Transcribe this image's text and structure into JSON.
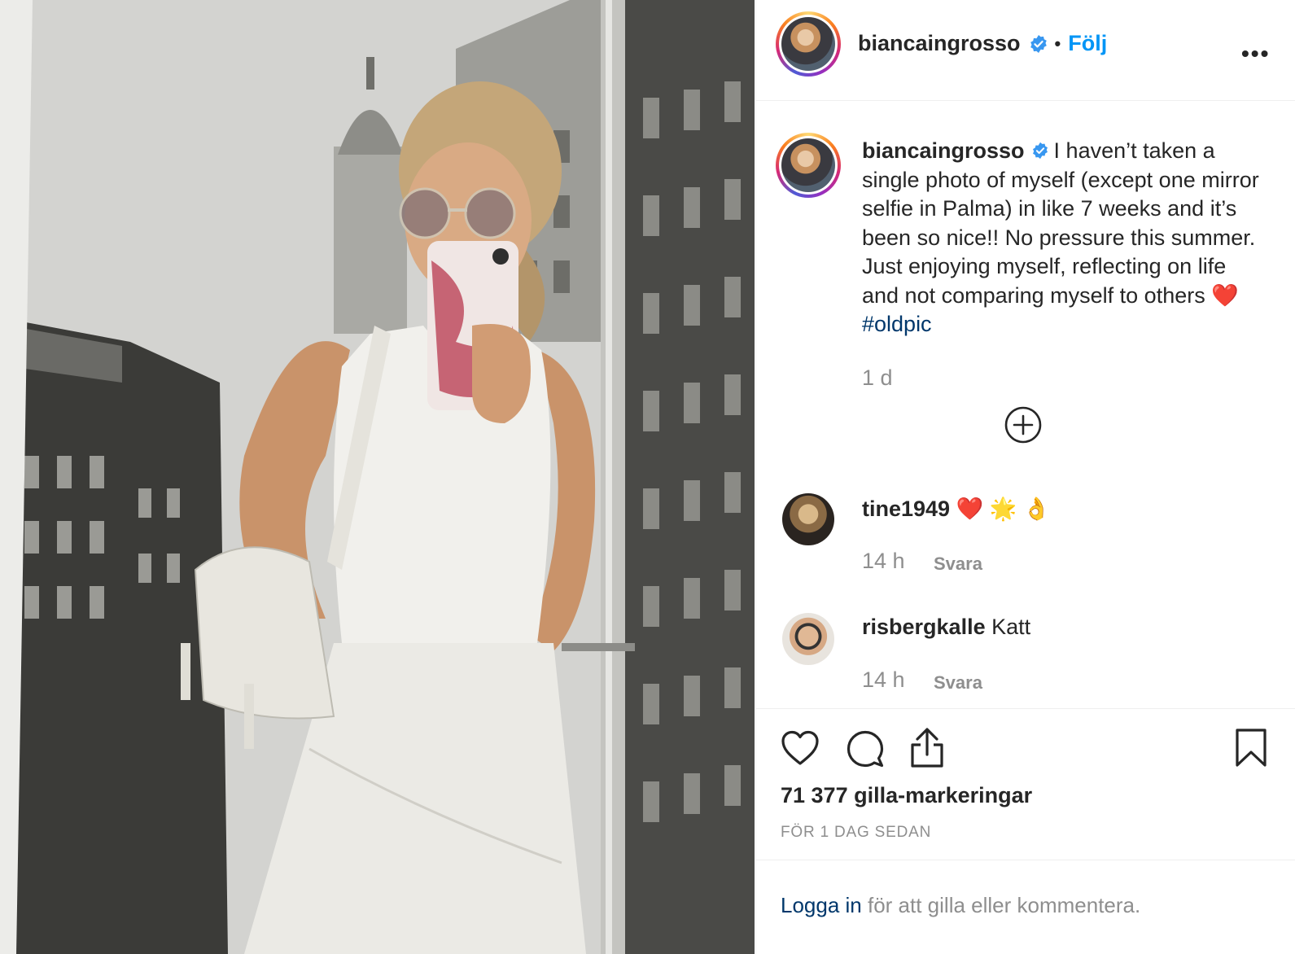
{
  "post": {
    "username": "biancaingrosso",
    "follow_label": "Följ",
    "dot": "•",
    "more_label": "•••",
    "verified_icon": "verified-badge-icon"
  },
  "caption": {
    "username": "biancaingrosso",
    "text": "I haven’t taken a single photo of myself (except one mirror selfie in Palma) in like 7 weeks and it’s been so nice!! No pressure this summer. Just enjoying myself, reflecting on life and not comparing myself to others",
    "emoji": "❤️",
    "hashtag": "#oldpic",
    "timestamp": "1 d"
  },
  "comments": [
    {
      "username": "tine1949",
      "text": "❤️ 🌟 👌",
      "timestamp": "14 h",
      "reply_label": "Svara"
    },
    {
      "username": "risbergkalle",
      "text": "Katt",
      "timestamp": "14 h",
      "reply_label": "Svara"
    }
  ],
  "stats": {
    "likes": "71 377 gilla-markeringar",
    "posted_ago": "FÖR 1 DAG SEDAN"
  },
  "footer": {
    "login_link": "Logga in",
    "login_text": " för att gilla eller kommentera."
  },
  "colors": {
    "accent": "#0095f6",
    "hashtag": "#00376b",
    "muted": "#8e8e8e",
    "text": "#262626"
  }
}
